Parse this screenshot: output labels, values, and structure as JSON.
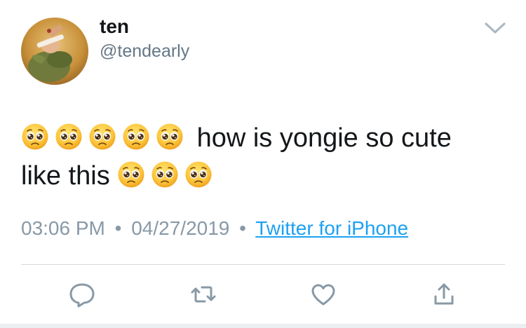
{
  "tweet": {
    "display_name": "ten",
    "handle": "@tendearly",
    "text_line1": "how is yongie so cute",
    "text_line2": "like this",
    "emoji_name": "pleading-face-emoji",
    "emoji_count_line1": 5,
    "emoji_count_line2": 3,
    "time": "03:06 PM",
    "separator": "•",
    "date": "04/27/2019",
    "source": "Twitter for iPhone"
  },
  "actions": {
    "reply_icon": "reply-icon",
    "retweet_icon": "retweet-icon",
    "like_icon": "heart-icon",
    "share_icon": "share-icon"
  },
  "colors": {
    "text": "#14171a",
    "secondary": "#657786",
    "meta": "#8899a6",
    "link": "#1da1f2",
    "icon": "#8899a6"
  }
}
